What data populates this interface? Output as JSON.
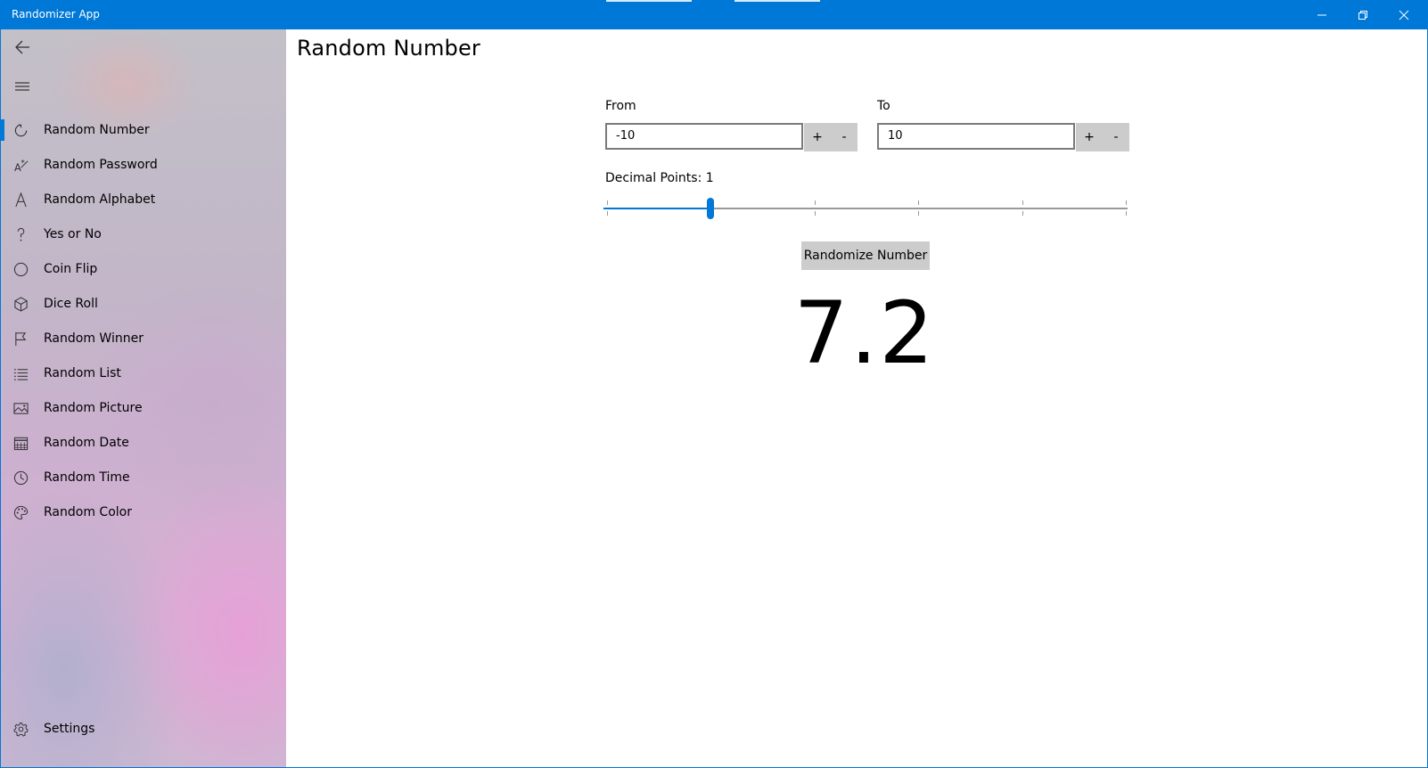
{
  "window": {
    "title": "Randomizer App"
  },
  "sidebar": {
    "items": [
      {
        "label": "Random Number",
        "icon": "refresh-icon",
        "selected": true
      },
      {
        "label": "Random Password",
        "icon": "password-icon"
      },
      {
        "label": "Random Alphabet",
        "icon": "letter-a-icon"
      },
      {
        "label": "Yes or No",
        "icon": "question-mark-icon"
      },
      {
        "label": "Coin Flip",
        "icon": "circle-icon"
      },
      {
        "label": "Dice Roll",
        "icon": "dice-icon"
      },
      {
        "label": "Random Winner",
        "icon": "flag-icon"
      },
      {
        "label": "Random List",
        "icon": "list-icon"
      },
      {
        "label": "Random Picture",
        "icon": "picture-icon"
      },
      {
        "label": "Random Date",
        "icon": "calendar-icon"
      },
      {
        "label": "Random Time",
        "icon": "clock-icon"
      },
      {
        "label": "Random Color",
        "icon": "palette-icon"
      }
    ],
    "settings": {
      "label": "Settings",
      "icon": "gear-icon"
    }
  },
  "main": {
    "title": "Random Number",
    "from": {
      "label": "From",
      "value": "-10",
      "plus": "+",
      "minus": "-"
    },
    "to": {
      "label": "To",
      "value": "10",
      "plus": "+",
      "minus": "-"
    },
    "decimal": {
      "label": "Decimal Points: 1",
      "value": 1,
      "min": 0,
      "max": 5
    },
    "button_label": "Randomize Number",
    "result": "7.2"
  },
  "colors": {
    "accent": "#0078d7",
    "button_bg": "#cccccc"
  }
}
